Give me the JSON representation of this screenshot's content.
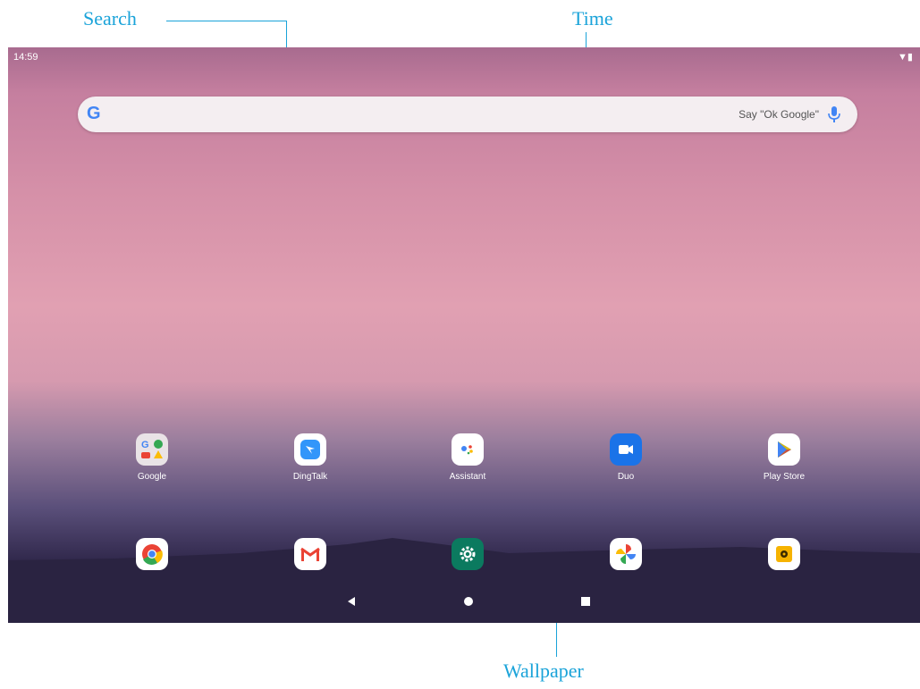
{
  "callouts": {
    "search": "Search",
    "time": "Time",
    "wallpaper": "Wallpaper"
  },
  "statusbar": {
    "time": "14:59",
    "wifi_icon": "wifi-icon"
  },
  "search": {
    "logo": "G",
    "hint": "Say \"Ok Google\"",
    "mic_icon": "mic-icon"
  },
  "apps_row1": [
    {
      "label": "Google",
      "icon": "google-folder-icon"
    },
    {
      "label": "DingTalk",
      "icon": "dingtalk-icon"
    },
    {
      "label": "Assistant",
      "icon": "assistant-icon"
    },
    {
      "label": "Duo",
      "icon": "duo-icon"
    },
    {
      "label": "Play Store",
      "icon": "play-store-icon"
    }
  ],
  "dock": [
    {
      "icon": "chrome-icon"
    },
    {
      "icon": "gmail-icon"
    },
    {
      "icon": "settings-icon"
    },
    {
      "icon": "photos-icon"
    },
    {
      "icon": "music-icon"
    }
  ],
  "nav": {
    "back": "back-icon",
    "home": "home-icon",
    "recents": "recents-icon"
  },
  "colors": {
    "callout": "#1aa3d9"
  }
}
